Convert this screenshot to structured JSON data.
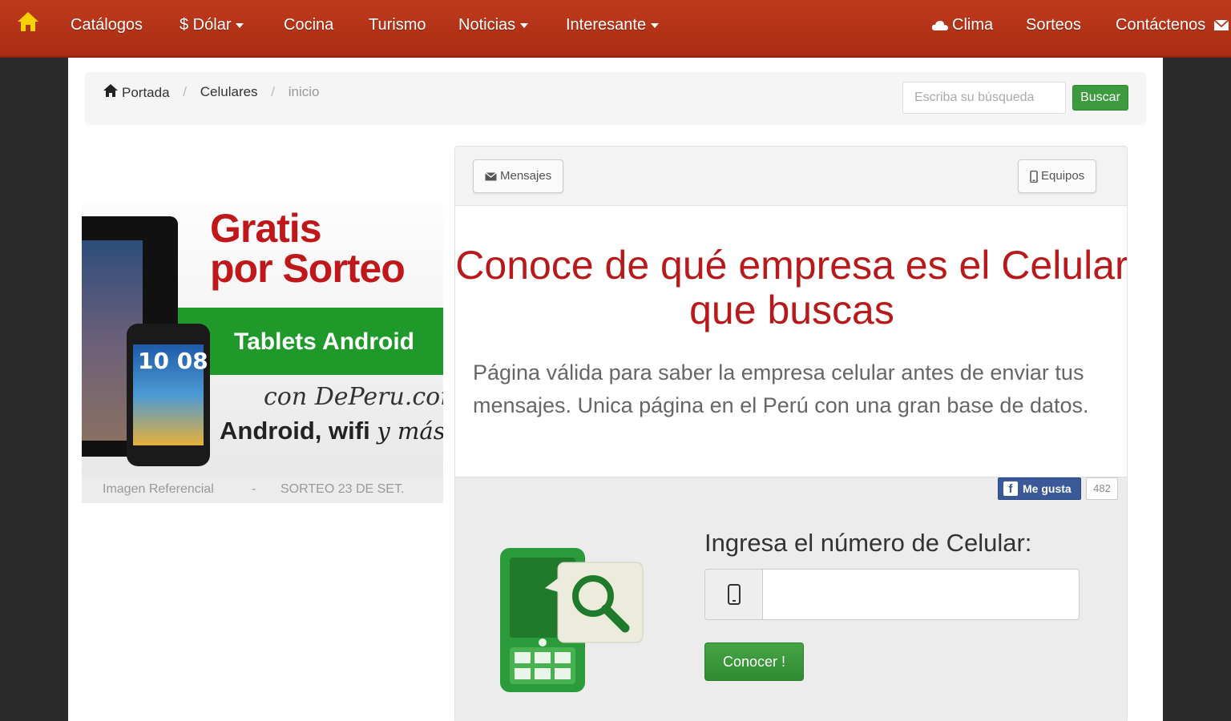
{
  "nav": {
    "items": [
      {
        "label": "Catálogos"
      },
      {
        "label": "$ Dólar"
      },
      {
        "label": "Cocina"
      },
      {
        "label": "Turismo"
      },
      {
        "label": "Noticias"
      },
      {
        "label": "Interesante"
      },
      {
        "label": "Clima"
      },
      {
        "label": "Sorteos"
      },
      {
        "label": "Contáctenos"
      }
    ],
    "bg_color": "#b3331a",
    "home_icon_color": "#f7d000"
  },
  "breadcrumb": {
    "items": [
      "Portada",
      "Celulares",
      "inicio"
    ]
  },
  "search": {
    "placeholder": "Escriba su búsqueda",
    "button_label": "Buscar"
  },
  "promo": {
    "title_line1": "Gratis",
    "title_line2": "por Sorteo",
    "band": "Tablets Android",
    "domain": "con DePeru.com",
    "sub_main": "Android, wifi",
    "sub_italic": "y más",
    "clock": "10 08",
    "footer_left": "Imagen Referencial",
    "footer_sep": "-",
    "footer_right": "SORTEO 23 DE SET."
  },
  "panel": {
    "tab_messages": "Mensajes",
    "tab_devices": "Equipos",
    "heading": "Conoce de qué empresa es el Celular que buscas",
    "description": "Página válida para saber la empresa celular antes de enviar tus mensajes. Unica página en el Perú con una gran base de datos.",
    "like_label": "Me gusta",
    "like_count": "482",
    "form_label": "Ingresa el número de Celular:",
    "input_value": "",
    "submit_label": "Conocer !"
  },
  "colors": {
    "heading_red": "#b8191a",
    "green": "#3e9a3e"
  }
}
